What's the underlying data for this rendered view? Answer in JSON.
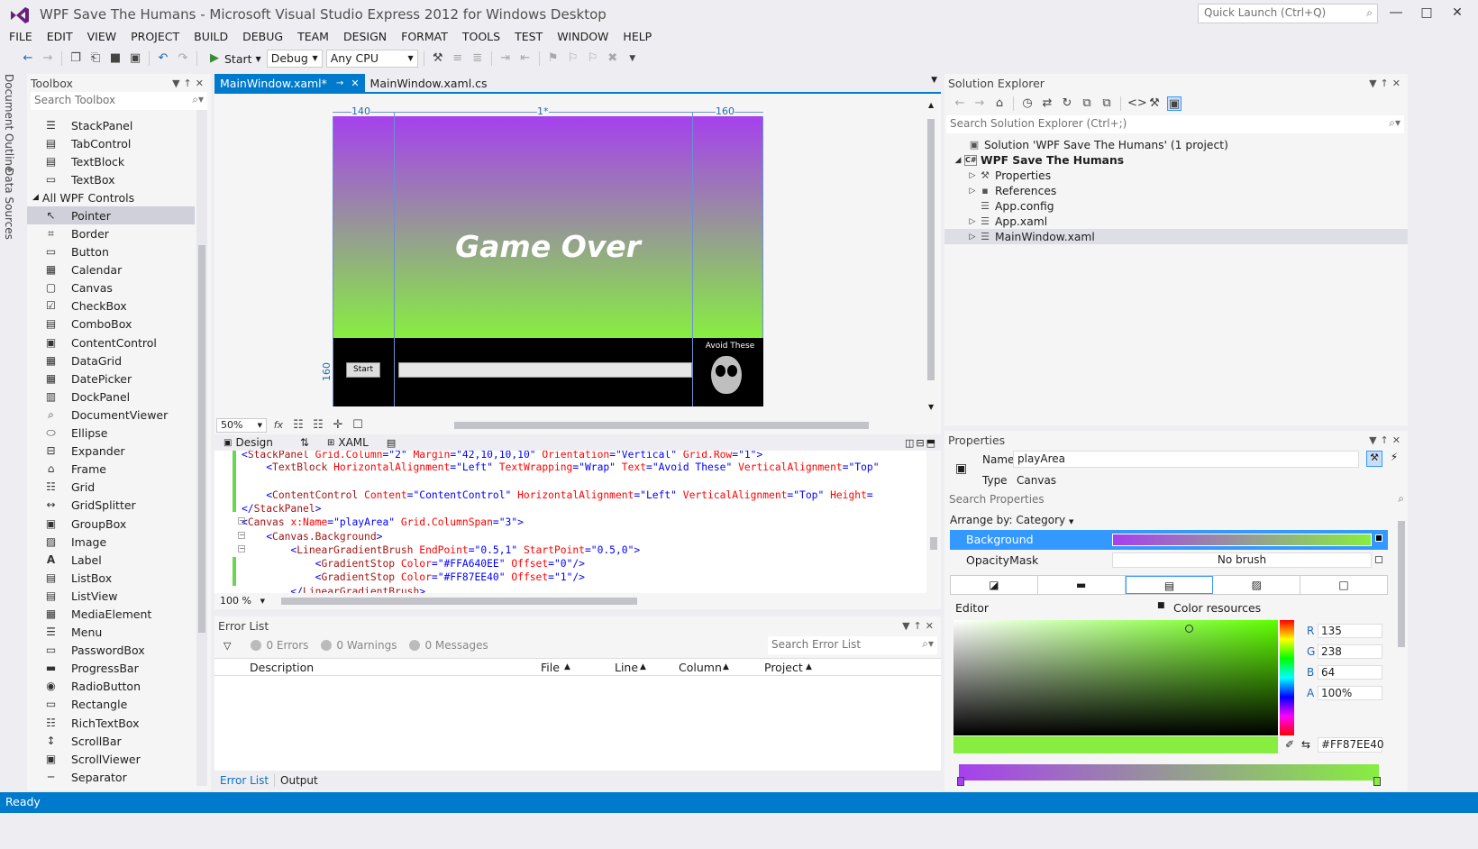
{
  "window": {
    "title": "WPF Save The Humans - Microsoft Visual Studio Express 2012 for Windows Desktop",
    "quick_launch_placeholder": "Quick Launch (Ctrl+Q)"
  },
  "menu": [
    "FILE",
    "EDIT",
    "VIEW",
    "PROJECT",
    "BUILD",
    "DEBUG",
    "TEAM",
    "DESIGN",
    "FORMAT",
    "TOOLS",
    "TEST",
    "WINDOW",
    "HELP"
  ],
  "toolbar": {
    "start_label": "Start",
    "config": "Debug",
    "platform": "Any CPU"
  },
  "side_tabs": [
    "Document Outline",
    "Data Sources"
  ],
  "toolbox": {
    "title": "Toolbox",
    "search_placeholder": "Search Toolbox",
    "common_items": [
      "StackPanel",
      "TabControl",
      "TextBlock",
      "TextBox"
    ],
    "category": "All WPF Controls",
    "items": [
      "Pointer",
      "Border",
      "Button",
      "Calendar",
      "Canvas",
      "CheckBox",
      "ComboBox",
      "ContentControl",
      "DataGrid",
      "DatePicker",
      "DockPanel",
      "DocumentViewer",
      "Ellipse",
      "Expander",
      "Frame",
      "Grid",
      "GridSplitter",
      "GroupBox",
      "Image",
      "Label",
      "ListBox",
      "ListView",
      "MediaElement",
      "Menu",
      "PasswordBox",
      "ProgressBar",
      "RadioButton",
      "Rectangle",
      "RichTextBox",
      "ScrollBar",
      "ScrollViewer",
      "Separator"
    ],
    "selected": "Pointer"
  },
  "doc_tabs": [
    {
      "label": "MainWindow.xaml*",
      "active": true
    },
    {
      "label": "MainWindow.xaml.cs",
      "active": false
    }
  ],
  "designer": {
    "game_over_text": "Game Over",
    "start_button": "Start",
    "avoid_text": "Avoid These",
    "ruler_left": "140",
    "ruler_mid": "1*",
    "ruler_right": "160",
    "ruler_vertical": "160",
    "zoom": "50%",
    "gradient_start": "#A640EE",
    "gradient_end": "#87EE40"
  },
  "split": {
    "design_label": "Design",
    "xaml_label": "XAML",
    "xaml_zoom": "100 %"
  },
  "xaml_lines": [
    "<StackPanel Grid.Column=\"2\" Margin=\"42,10,10,10\" Orientation=\"Vertical\" Grid.Row=\"1\">",
    "    <TextBlock HorizontalAlignment=\"Left\" TextWrapping=\"Wrap\" Text=\"Avoid These\" VerticalAlignment=\"Top\"",
    "",
    "    <ContentControl Content=\"ContentControl\" HorizontalAlignment=\"Left\" VerticalAlignment=\"Top\" Height=\"",
    "</StackPanel>",
    "<Canvas x:Name=\"playArea\" Grid.ColumnSpan=\"3\">",
    "    <Canvas.Background>",
    "        <LinearGradientBrush EndPoint=\"0.5,1\" StartPoint=\"0.5,0\">",
    "            <GradientStop Color=\"#FFA640EE\" Offset=\"0\"/>",
    "            <GradientStop Color=\"#FF87EE40\" Offset=\"1\"/>",
    "        </LinearGradientBrush>"
  ],
  "error_list": {
    "title": "Error List",
    "errors": "0 Errors",
    "warnings": "0 Warnings",
    "messages": "0 Messages",
    "search_placeholder": "Search Error List",
    "columns": [
      "Description",
      "File",
      "Line",
      "Column",
      "Project"
    ],
    "bottom_tabs": [
      "Error List",
      "Output"
    ]
  },
  "solution_explorer": {
    "title": "Solution Explorer",
    "search_placeholder": "Search Solution Explorer (Ctrl+;)",
    "nodes": [
      {
        "label": "Solution 'WPF Save The Humans' (1 project)",
        "level": 0,
        "expander": "",
        "icon": "▣"
      },
      {
        "label": "WPF Save The Humans",
        "level": 0,
        "expander": "◢",
        "icon": "C#",
        "bold": true
      },
      {
        "label": "Properties",
        "level": 1,
        "expander": "▷",
        "icon": "⚒"
      },
      {
        "label": "References",
        "level": 1,
        "expander": "▷",
        "icon": "▪"
      },
      {
        "label": "App.config",
        "level": 1,
        "expander": "",
        "icon": "☰"
      },
      {
        "label": "App.xaml",
        "level": 1,
        "expander": "▷",
        "icon": "☰"
      },
      {
        "label": "MainWindow.xaml",
        "level": 1,
        "expander": "▷",
        "icon": "☰",
        "selected": true
      }
    ]
  },
  "properties": {
    "title": "Properties",
    "name_label": "Name",
    "name_value": "playArea",
    "type_label": "Type",
    "type_value": "Canvas",
    "search_placeholder": "Search Properties",
    "arrange_by": "Arrange by: Category",
    "background_label": "Background",
    "opacity_mask_label": "OpacityMask",
    "opacity_mask_value": "No brush",
    "editor_label": "Editor",
    "color_resources_label": "Color resources",
    "r_label": "R",
    "r": "135",
    "g_label": "G",
    "g": "238",
    "b_label": "B",
    "b": "64",
    "a_label": "A",
    "a": "100%",
    "hex": "#FF87EE40",
    "selected_color": "#87EE40"
  },
  "status": {
    "text": "Ready"
  }
}
